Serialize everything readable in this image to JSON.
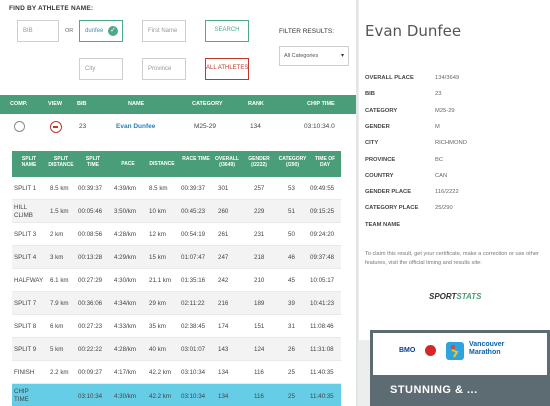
{
  "search": {
    "title": "FIND BY ATHLETE NAME:",
    "bib_placeholder": "BIB",
    "or_label": "OR",
    "last_name_value": "dunfee",
    "first_name_placeholder": "First Name",
    "city_placeholder": "City",
    "province_placeholder": "Province",
    "search_button": "SEARCH",
    "all_athletes_button": "ALL ATHLETES",
    "filter_label": "FILTER RESULTS:",
    "filter_value": "All Categories",
    "filter_caret": "▾",
    "check_icon": "✓"
  },
  "results": {
    "headers": {
      "comp": "COMP.",
      "view": "VIEW",
      "bib": "BIB",
      "name": "NAME",
      "category": "CATEGORY",
      "rank": "RANK",
      "chip_time": "CHIP TIME"
    },
    "row": {
      "bib": "23",
      "name": "Evan Dunfee",
      "category": "M25-29",
      "rank": "134",
      "chip_time": "03:10:34.0"
    }
  },
  "splits": {
    "headers": {
      "split": "SPLIT NAME",
      "split_distance": "SPLIT DISTANCE",
      "split_time": "SPLIT TIME",
      "pace": "PACE",
      "distance": "DISTANCE",
      "race_time": "RACE TIME",
      "overall": "OVERALL (/3649)",
      "gender": "GENDER (/2222)",
      "category": "CATEGORY (/290)",
      "tod": "TIME OF DAY"
    },
    "rows": [
      {
        "name": "SPLIT 1",
        "sdist": "8.5 km",
        "stime": "00:39:37",
        "pace": "4:39/km",
        "dist": "8.5 km",
        "rtime": "00:39:37",
        "overall": "301",
        "gender": "257",
        "cat": "53",
        "tod": "09:49:55"
      },
      {
        "name": "HILL CLIMB",
        "sdist": "1.5 km",
        "stime": "00:05:46",
        "pace": "3:50/km",
        "dist": "10 km",
        "rtime": "00:45:23",
        "overall": "260",
        "gender": "229",
        "cat": "51",
        "tod": "09:15:25"
      },
      {
        "name": "SPLIT 3",
        "sdist": "2 km",
        "stime": "00:08:56",
        "pace": "4:28/km",
        "dist": "12 km",
        "rtime": "00:54:19",
        "overall": "261",
        "gender": "231",
        "cat": "50",
        "tod": "09:24:20"
      },
      {
        "name": "SPLIT 4",
        "sdist": "3 km",
        "stime": "00:13:28",
        "pace": "4:29/km",
        "dist": "15 km",
        "rtime": "01:07:47",
        "overall": "247",
        "gender": "218",
        "cat": "46",
        "tod": "09:37:48"
      },
      {
        "name": "HALFWAY",
        "sdist": "6.1 km",
        "stime": "00:27:29",
        "pace": "4:30/km",
        "dist": "21.1 km",
        "rtime": "01:35:16",
        "overall": "242",
        "gender": "210",
        "cat": "45",
        "tod": "10:05:17"
      },
      {
        "name": "SPLIT 7",
        "sdist": "7.9 km",
        "stime": "00:36:06",
        "pace": "4:34/km",
        "dist": "29 km",
        "rtime": "02:11:22",
        "overall": "216",
        "gender": "189",
        "cat": "39",
        "tod": "10:41:23"
      },
      {
        "name": "SPLIT 8",
        "sdist": "6 km",
        "stime": "00:27:23",
        "pace": "4:33/km",
        "dist": "35 km",
        "rtime": "02:38:45",
        "overall": "174",
        "gender": "151",
        "cat": "31",
        "tod": "11:08:46"
      },
      {
        "name": "SPLIT 9",
        "sdist": "5 km",
        "stime": "00:22:22",
        "pace": "4:28/km",
        "dist": "40 km",
        "rtime": "03:01:07",
        "overall": "143",
        "gender": "124",
        "cat": "26",
        "tod": "11:31:08"
      },
      {
        "name": "FINISH",
        "sdist": "2.2 km",
        "stime": "00:09:27",
        "pace": "4:17/km",
        "dist": "42.2 km",
        "rtime": "03:10:34",
        "overall": "134",
        "gender": "116",
        "cat": "25",
        "tod": "11:40:35"
      }
    ],
    "chip_row": {
      "name": "CHIP TIME",
      "sdist": "",
      "stime": "03:10:34",
      "pace": "4:30/km",
      "dist": "42.2 km",
      "rtime": "03:10:34",
      "overall": "134",
      "gender": "116",
      "cat": "25",
      "tod": "11:40:35"
    }
  },
  "athlete": {
    "name": "Evan Dunfee",
    "details": [
      {
        "label": "OVERALL PLACE",
        "value": "134/3649"
      },
      {
        "label": "BIB",
        "value": "23"
      },
      {
        "label": "CATEGORY",
        "value": "M25-29"
      },
      {
        "label": "GENDER",
        "value": "M"
      },
      {
        "label": "CITY",
        "value": "RICHMOND"
      },
      {
        "label": "PROVINCE",
        "value": "BC"
      },
      {
        "label": "COUNTRY",
        "value": "CAN"
      },
      {
        "label": "GENDER PLACE",
        "value": "116/2222"
      },
      {
        "label": "CATEGORY PLACE",
        "value": "25/290"
      },
      {
        "label": "TEAM NAME",
        "value": ""
      }
    ],
    "claim_text": "To claim this result, get your certificate, make a correction or use other features, visit the official timing and results site:",
    "sportstats_a": "SPORT",
    "sportstats_b": "STATS"
  },
  "ad": {
    "bmo": "BMO",
    "vancouver": "Vancouver",
    "marathon": "Marathon",
    "stunning": "STUNNING & ..."
  },
  "colors": {
    "header_green": "#4a9d79",
    "chip_row_blue": "#66cde6",
    "link_blue": "#2b7fb8",
    "warn_red": "#c0392b"
  }
}
